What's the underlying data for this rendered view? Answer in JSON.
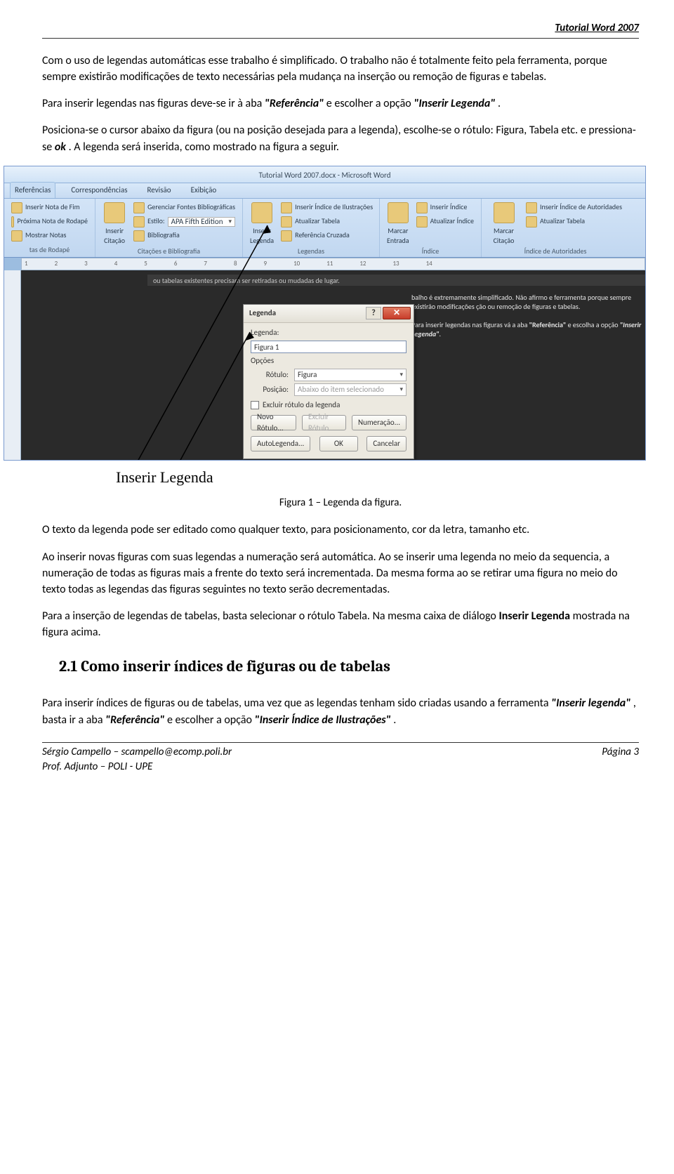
{
  "header": {
    "title": "Tutorial Word 2007"
  },
  "p1_a": "Com o uso de legendas automáticas esse trabalho é simplificado. O trabalho não é totalmente feito pela ferramenta, porque sempre existirão modificações de texto necessárias pela mudança na inserção ou remoção de figuras e tabelas.",
  "p2_a": "Para inserir legendas nas figuras deve-se ir à aba ",
  "p2_b": "\"Referência\"",
  "p2_c": " e escolher a opção ",
  "p2_d": "\"Inserir Legenda\"",
  "p2_e": ".",
  "p3_a": "Posiciona-se o cursor abaixo da figura (ou na posição desejada para a legenda), escolhe-se o rótulo: Figura, Tabela etc. e pressiona-se ",
  "p3_b": "ok",
  "p3_c": ". A legenda será inserida, como mostrado na figura a seguir.",
  "screenshot": {
    "title": "Tutorial Word 2007.docx - Microsoft Word",
    "tabs": [
      "Referências",
      "Correspondências",
      "Revisão",
      "Exibição"
    ],
    "ribbon": {
      "g1": {
        "items": [
          "Inserir Nota de Fim",
          "Próxima Nota de Rodapé",
          "Mostrar Notas"
        ],
        "label": "tas de Rodapé"
      },
      "g2": {
        "big": "Inserir Citação",
        "items": [
          "Gerenciar Fontes Bibliográficas",
          "Estilo:",
          "Bibliografia"
        ],
        "style_val": "APA Fifth Edition",
        "label": "Citações e Bibliografia"
      },
      "g3": {
        "big": "Inserir Legenda",
        "items": [
          "Inserir Índice de Ilustrações",
          "Atualizar Tabela",
          "Referência Cruzada"
        ],
        "label": "Legendas"
      },
      "g4": {
        "big": "Marcar Entrada",
        "items": [
          "Inserir Índice",
          "Atualizar Índice"
        ],
        "label": "Índice"
      },
      "g5": {
        "big": "Marcar Citação",
        "items": [
          "Inserir Índice de Autoridades",
          "Atualizar Tabela"
        ],
        "label": "Índice de Autoridades"
      }
    },
    "ruler_marks": [
      "1",
      "2",
      "3",
      "4",
      "5",
      "6",
      "7",
      "8",
      "9",
      "10",
      "11",
      "12",
      "13",
      "14"
    ],
    "doc_preview_line": "ou tabelas existentes precisam ser retiradas ou mudadas de lugar.",
    "doc_bg_text1": "balho é extremamente simplificado. Não afirmo e ferramenta porque sempre existirão modificações ção ou remoção de figuras e tabelas.",
    "doc_bg_text2_a": "Para inserir legendas nas figuras vá a aba ",
    "doc_bg_text2_b": "\"Referência\"",
    "doc_bg_text2_c": " e escolha a opção ",
    "doc_bg_text2_d": "\"Inserir Legenda\"",
    "doc_bg_text2_e": ".",
    "dialog": {
      "title": "Legenda",
      "lbl_legenda": "Legenda:",
      "val_legenda": "Figura 1",
      "lbl_opcoes": "Opções",
      "lbl_rotulo": "Rótulo:",
      "val_rotulo": "Figura",
      "lbl_posicao": "Posição:",
      "val_posicao": "Abaixo do item selecionado",
      "chk_excluir": "Excluir rótulo da legenda",
      "btn_novo": "Novo Rótulo...",
      "btn_excluir": "Excluir Rótulo",
      "btn_numer": "Numeração...",
      "btn_auto": "AutoLegenda...",
      "btn_ok": "OK",
      "btn_cancel": "Cancelar"
    }
  },
  "callout": "Inserir Legenda",
  "figcaption": "Figura 1 – Legenda da figura.",
  "p4": "O texto da legenda pode ser editado como qualquer texto, para posicionamento, cor da letra, tamanho etc.",
  "p5": "Ao inserir novas figuras com suas legendas a numeração será automática. Ao se inserir uma legenda no meio da sequencia, a numeração de todas as figuras mais a frente do texto será incrementada. Da mesma forma ao se retirar uma figura no meio do texto todas as legendas das figuras seguintes no texto serão decrementadas.",
  "p6_a": "Para a inserção de legendas de tabelas, basta selecionar o rótulo Tabela. Na mesma caixa de diálogo ",
  "p6_b": "Inserir Legenda",
  "p6_c": " mostrada na figura acima.",
  "h2": "2.1 Como inserir índices de figuras ou de tabelas",
  "p7_a": "Para inserir índices de figuras ou de tabelas, uma vez que as legendas tenham sido criadas usando a ferramenta ",
  "p7_b": "\"Inserir legenda\"",
  "p7_c": ",  basta ir a aba ",
  "p7_d": "\"Referência\"",
  "p7_e": " e escolher a opção ",
  "p7_f": "\"Inserir Índice de Ilustrações\"",
  "p7_g": ".",
  "footer": {
    "author": "Sérgio Campello – scampello@ecomp.poli.br",
    "role": "Prof. Adjunto – POLI - UPE",
    "page": "Página 3"
  }
}
